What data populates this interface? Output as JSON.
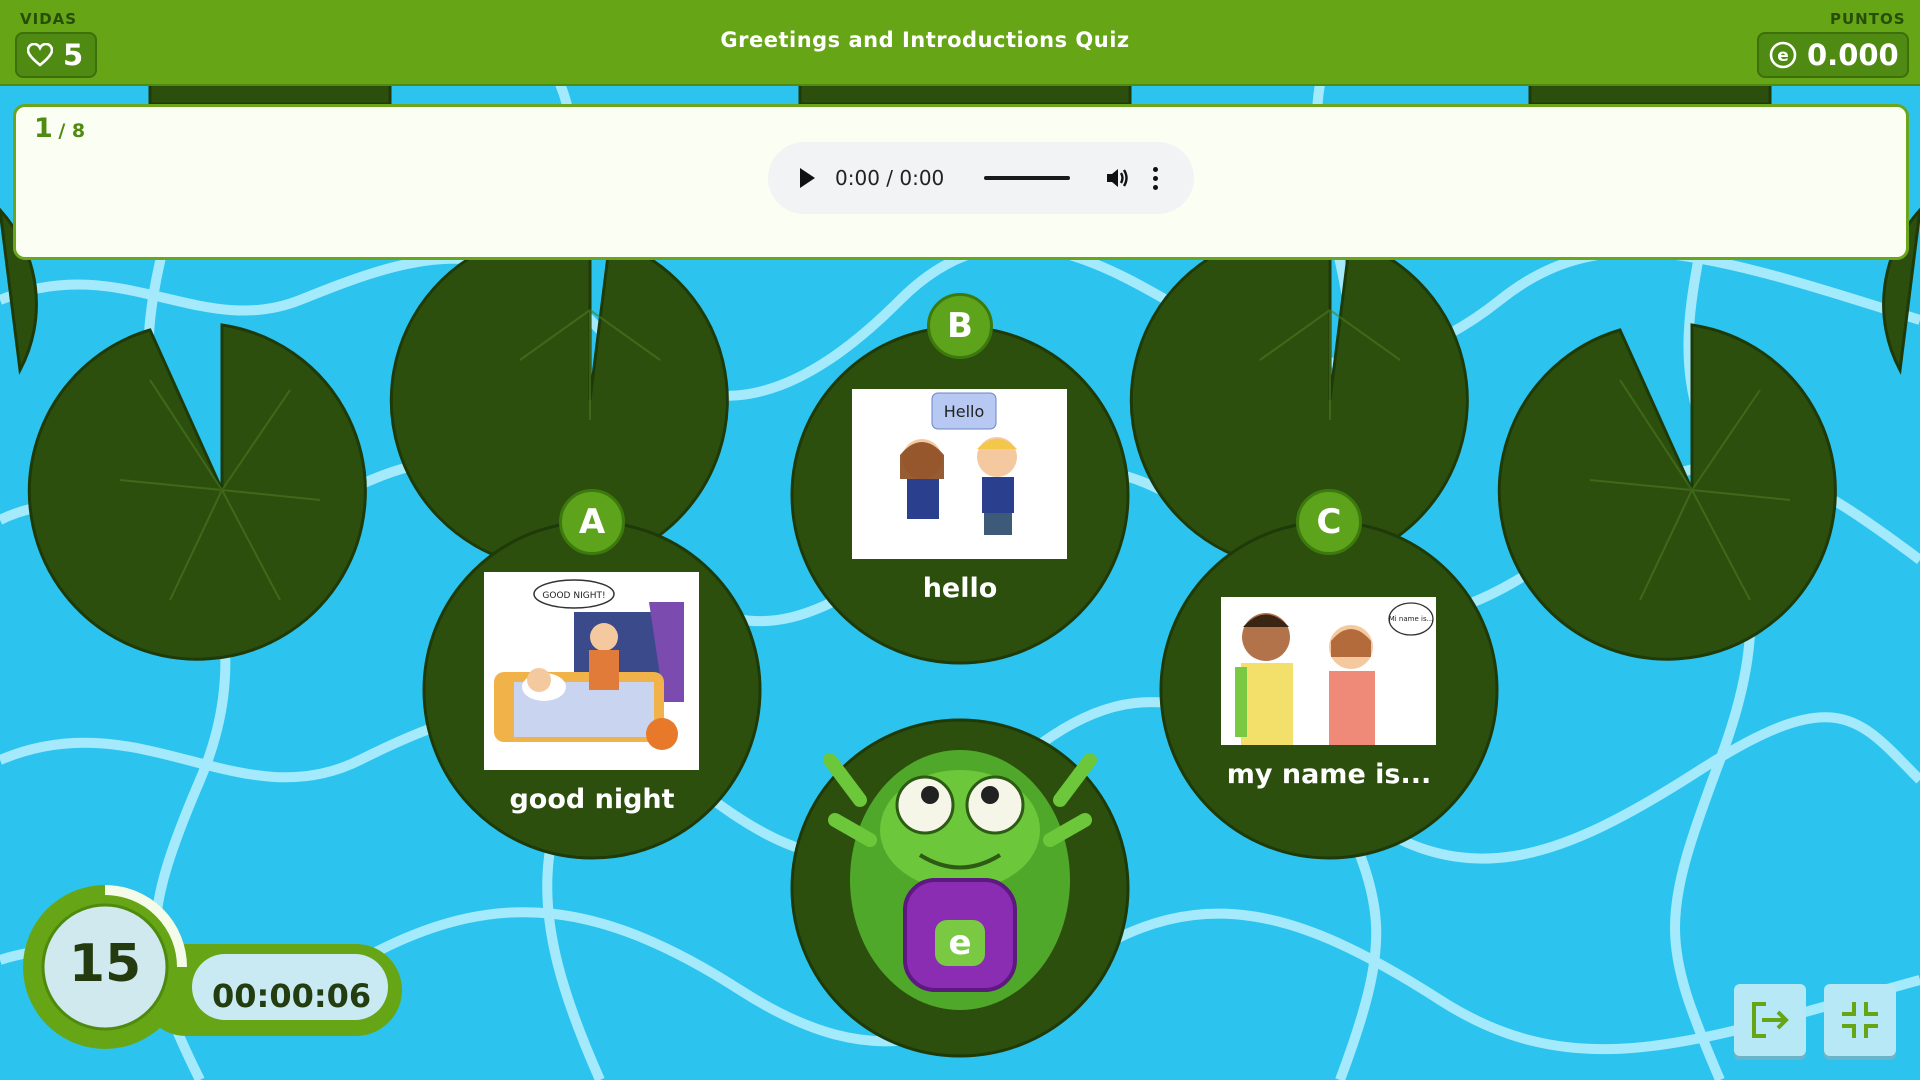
{
  "header": {
    "lives_label": "VIDAS",
    "lives_value": "5",
    "title": "Greetings and Introductions Quiz",
    "points_label": "PUNTOS",
    "points_value": "0.000"
  },
  "question": {
    "current": "1",
    "total": "/ 8",
    "audio_time": "0:00 / 0:00"
  },
  "options": [
    {
      "letter": "A",
      "word": "good night",
      "image_text": "GOOD NIGHT!"
    },
    {
      "letter": "B",
      "word": "hello",
      "image_text": "Hello"
    },
    {
      "letter": "C",
      "word": "my name is...",
      "image_text": "Mi name is..."
    }
  ],
  "timer": {
    "countdown": "15",
    "elapsed": "00:00:06"
  },
  "mascot": {
    "badge_letter": "e"
  },
  "colors": {
    "header_green": "#66a516",
    "pad_dark": "#2d4f0e",
    "water": "#2cc4ee",
    "badge_green": "#5ea31c"
  },
  "icons": {
    "lives": "heart-icon",
    "points": "coin-icon",
    "exit": "exit-icon",
    "fullscreen": "fullscreen-exit-icon"
  }
}
